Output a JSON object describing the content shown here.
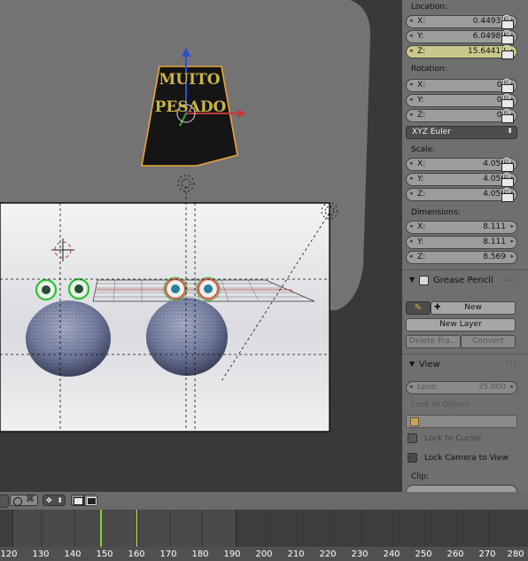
{
  "viewport": {
    "text_top": "MUITO",
    "text_bottom": "PESADO"
  },
  "properties": {
    "location_label": "Location:",
    "location": [
      {
        "axis": "X:",
        "value": "0.44933"
      },
      {
        "axis": "Y:",
        "value": "6.04989"
      },
      {
        "axis": "Z:",
        "value": "15.64413"
      }
    ],
    "rotation_label": "Rotation:",
    "rotation": [
      {
        "axis": "X:",
        "value": "0°"
      },
      {
        "axis": "Y:",
        "value": "0°"
      },
      {
        "axis": "Z:",
        "value": "0°"
      }
    ],
    "rotation_mode": "XYZ Euler",
    "scale_label": "Scale:",
    "scale": [
      {
        "axis": "X:",
        "value": "4.056"
      },
      {
        "axis": "Y:",
        "value": "4.056"
      },
      {
        "axis": "Z:",
        "value": "4.056"
      }
    ],
    "dimensions_label": "Dimensions:",
    "dimensions": [
      {
        "axis": "X:",
        "value": "8.111"
      },
      {
        "axis": "Y:",
        "value": "8.111"
      },
      {
        "axis": "Z:",
        "value": "8.569"
      }
    ],
    "grease_pencil": {
      "title": "Grease Pencil",
      "new_label": "New",
      "new_layer_label": "New Layer",
      "delete_frame_label": "Delete Fra...",
      "convert_label": "Convert"
    },
    "view": {
      "title": "View",
      "lens_label": "Lens:",
      "lens_value": "35.000",
      "lock_to_object_label": "Lock to Object:",
      "lock_to_cursor_label": "Lock to Cursor",
      "lock_camera_label": "Lock Camera to View",
      "clip_label": "Clip:"
    }
  },
  "timeline": {
    "ticks": [
      "120",
      "130",
      "140",
      "150",
      "160",
      "170",
      "180",
      "190",
      "200",
      "210",
      "220",
      "230",
      "240",
      "250",
      "260",
      "270",
      "280"
    ]
  },
  "colors": {
    "selected_outline": "#e8a53a",
    "axis_x": "#c23a3a",
    "axis_y": "#3aa03a",
    "axis_z": "#2b4fd0",
    "current_frame": "#8ad13a",
    "marker": "#d8d06a",
    "highlight_field": "#c9c78a"
  }
}
